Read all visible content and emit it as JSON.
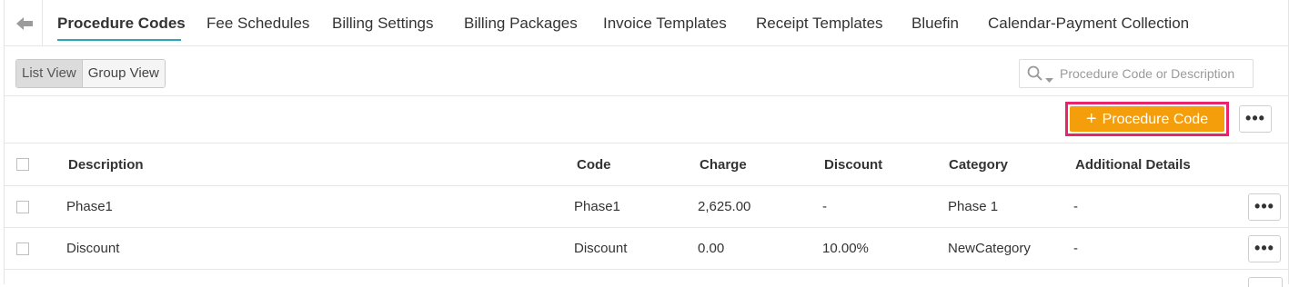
{
  "tabs": [
    {
      "label": "Procedure Codes",
      "active": true
    },
    {
      "label": "Fee Schedules"
    },
    {
      "label": "Billing Settings"
    },
    {
      "label": "Billing Packages"
    },
    {
      "label": "Invoice Templates"
    },
    {
      "label": "Receipt Templates"
    },
    {
      "label": "Bluefin"
    },
    {
      "label": "Calendar-Payment Collection"
    }
  ],
  "view_toggle": {
    "list_label": "List View",
    "group_label": "Group View",
    "selected": "List View"
  },
  "search": {
    "placeholder": "Procedure Code or Description",
    "value": ""
  },
  "actions": {
    "add_label": "Procedure Code",
    "add_icon": "plus-icon",
    "more_icon": "ellipsis-icon"
  },
  "table": {
    "headers": {
      "description": "Description",
      "code": "Code",
      "charge": "Charge",
      "discount": "Discount",
      "category": "Category",
      "additional": "Additional Details"
    },
    "rows": [
      {
        "description": "Phase1",
        "code": "Phase1",
        "charge": "2,625.00",
        "discount": "-",
        "category": "Phase 1",
        "additional": "-"
      },
      {
        "description": "Discount",
        "code": "Discount",
        "charge": "0.00",
        "discount": "10.00%",
        "category": "NewCategory",
        "additional": "-"
      }
    ]
  },
  "colors": {
    "accent_underline": "#2aa7b8",
    "add_button": "#f59e0b",
    "highlight_border": "#e8246a"
  }
}
